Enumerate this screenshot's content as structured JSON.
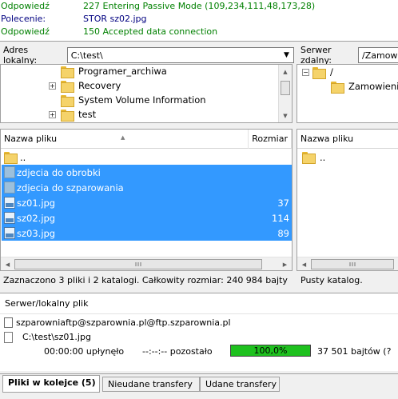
{
  "log": [
    {
      "label": "Odpowiedź",
      "text": "227 Entering Passive Mode (109,234,111,48,173,28)",
      "kind": "resp"
    },
    {
      "label": "Polecenie:",
      "text": "STOR sz02.jpg",
      "kind": "cmd"
    },
    {
      "label": "Odpowiedź",
      "text": "150 Accepted data connection",
      "kind": "resp"
    }
  ],
  "local": {
    "address_label": "Adres lokalny:",
    "address_value": "C:\\test\\",
    "tree": [
      "Programer_archiwa",
      "Recovery",
      "System Volume Information",
      "test"
    ],
    "columns": {
      "name": "Nazwa pliku",
      "size": "Rozmiar p"
    },
    "files": [
      {
        "name": "..",
        "size": ""
      },
      {
        "name": "zdjecia do obrobki",
        "size": ""
      },
      {
        "name": "zdjecia do szparowania",
        "size": ""
      },
      {
        "name": "sz01.jpg",
        "size": "37"
      },
      {
        "name": "sz02.jpg",
        "size": "114"
      },
      {
        "name": "sz03.jpg",
        "size": "89"
      }
    ],
    "status": "Zaznaczono 3 pliki i 2 katalogi. Całkowity rozmiar: 240 984 bajty"
  },
  "remote": {
    "address_label": "Serwer zdalny:",
    "address_value": "/Zamowie",
    "tree": [
      "/",
      "Zamowienie"
    ],
    "columns": {
      "name": "Nazwa pliku"
    },
    "files": [
      {
        "name": ".."
      }
    ],
    "status": "Pusty katalog."
  },
  "queue": {
    "header": "Serwer/lokalny plik",
    "server": "szparowniaftp@szparownia.pl@ftp.szparownia.pl",
    "local_file": "C:\\test\\sz01.jpg",
    "elapsed": "00:00:00 upłynęło",
    "remaining": "--:--:-- pozostało",
    "progress_text": "100,0%",
    "progress": 1.0,
    "bytes": "37 501 bajtów (?"
  },
  "tabs": [
    "Pliki w kolejce (5)",
    "Nieudane transfery",
    "Udane transfery"
  ],
  "colors": {
    "selection": "#3399ff",
    "progress": "#1ec11e",
    "response": "#008000",
    "command": "#000080"
  }
}
